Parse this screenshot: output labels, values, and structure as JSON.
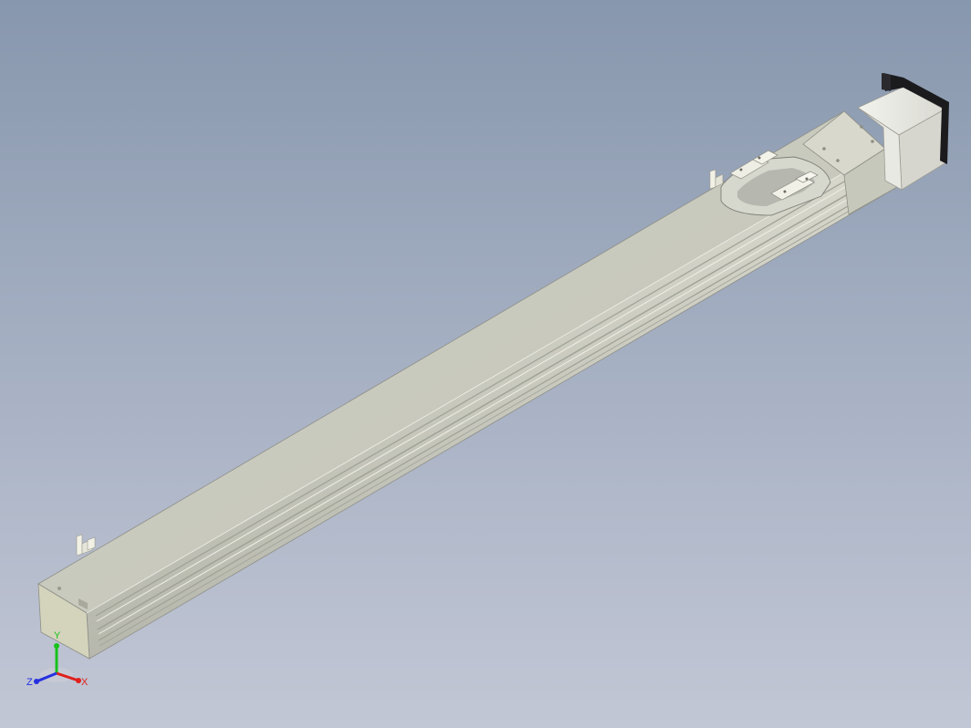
{
  "viewport": {
    "background_top": "#8797ad",
    "background_bottom": "#c2c7d5",
    "model": "linear-actuator"
  },
  "triad": {
    "x_label": "X",
    "y_label": "Y",
    "z_label": "Z",
    "x_color": "#e0201a",
    "y_color": "#16c21c",
    "z_color": "#2630e0"
  }
}
